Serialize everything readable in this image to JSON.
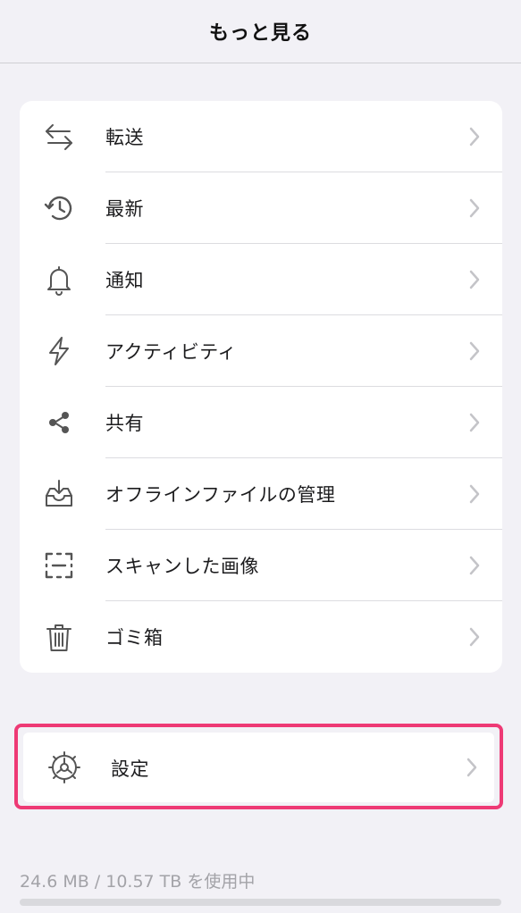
{
  "header": {
    "title": "もっと見る"
  },
  "menu": {
    "items": [
      {
        "label": "転送",
        "icon": "transfer-arrows-icon"
      },
      {
        "label": "最新",
        "icon": "history-icon"
      },
      {
        "label": "通知",
        "icon": "bell-icon"
      },
      {
        "label": "アクティビティ",
        "icon": "lightning-icon"
      },
      {
        "label": "共有",
        "icon": "share-icon"
      },
      {
        "label": "オフラインファイルの管理",
        "icon": "offline-tray-icon"
      },
      {
        "label": "スキャンした画像",
        "icon": "scan-icon"
      },
      {
        "label": "ゴミ箱",
        "icon": "trash-icon"
      }
    ]
  },
  "settings": {
    "label": "設定",
    "icon": "gear-icon",
    "highlight_color": "#ee3a75"
  },
  "storage": {
    "text": "24.6 MB / 10.57 TB を使用中",
    "used_fraction": 0.0
  },
  "colors": {
    "background": "#f2f1f6",
    "card": "#ffffff",
    "chevron": "#c4c4c8",
    "icon": "#555555"
  }
}
